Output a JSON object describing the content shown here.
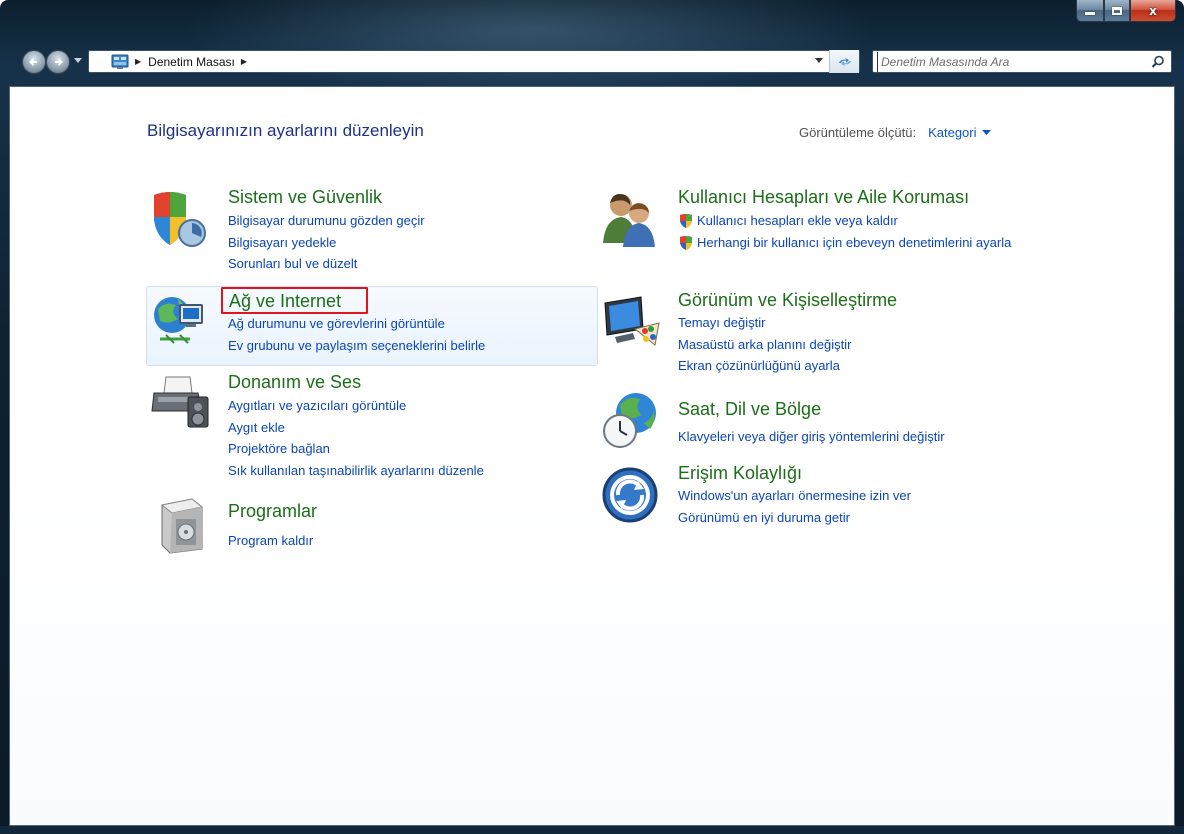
{
  "window": {
    "caption_buttons": {
      "minimize_glyph": "minimize-icon",
      "maximize_glyph": "maximize-icon",
      "close_glyph": "x"
    }
  },
  "address": {
    "crumb": "Denetim Masası",
    "crumb_separator": "▶",
    "icon": "control-panel-icon"
  },
  "search": {
    "placeholder": "Denetim Masasında Ara"
  },
  "header": {
    "title": "Bilgisayarınızın ayarlarını düzenleyin",
    "view_by_label": "Görüntüleme ölçütü:",
    "view_by_value": "Kategori"
  },
  "categories": {
    "system": {
      "title": "Sistem ve Güvenlik",
      "icon": "shield-security-icon",
      "links": [
        "Bilgisayar durumunu gözden geçir",
        "Bilgisayarı yedekle",
        "Sorunları bul ve düzelt"
      ]
    },
    "network": {
      "title": "Ağ ve Internet",
      "icon": "network-globe-icon",
      "links": [
        "Ağ durumunu ve görevlerini görüntüle",
        "Ev grubunu ve paylaşım seçeneklerini belirle"
      ],
      "highlighted": true
    },
    "hardware": {
      "title": "Donanım ve Ses",
      "icon": "printer-speaker-icon",
      "links": [
        "Aygıtları ve yazıcıları görüntüle",
        "Aygıt ekle",
        "Projektöre bağlan",
        "Sık kullanılan taşınabilirlik ayarlarını düzenle"
      ]
    },
    "programs": {
      "title": "Programlar",
      "icon": "programs-box-icon",
      "links": [
        "Program kaldır"
      ]
    },
    "users": {
      "title": "Kullanıcı Hesapları ve Aile Koruması",
      "icon": "users-icon",
      "links": [
        "Kullanıcı hesapları ekle veya kaldır",
        "Herhangi bir kullanıcı için ebeveyn denetimlerini ayarla"
      ]
    },
    "appearance": {
      "title": "Görünüm ve Kişiselleştirme",
      "icon": "monitor-palette-icon",
      "links": [
        "Temayı değiştir",
        "Masaüstü arka planını değiştir",
        "Ekran çözünürlüğünü ayarla"
      ]
    },
    "clock": {
      "title": "Saat, Dil ve Bölge",
      "icon": "globe-clock-icon",
      "links": [
        "Klavyeleri veya diğer giriş yöntemlerini değiştir"
      ]
    },
    "ease": {
      "title": "Erişim Kolaylığı",
      "icon": "ease-of-access-icon",
      "links": [
        "Windows'un ayarları önermesine izin ver",
        "Görünümü en iyi duruma getir"
      ]
    }
  },
  "colors": {
    "title_green": "#1c6e18",
    "link_blue": "#0b45b8",
    "header_blue": "#1e3287",
    "highlight_red": "#e0151d"
  }
}
